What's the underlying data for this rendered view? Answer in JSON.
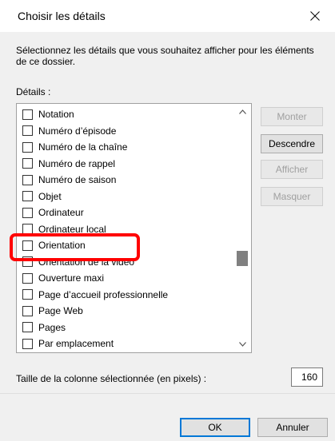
{
  "window": {
    "title": "Choisir les détails",
    "close_icon": "close-icon"
  },
  "description": "Sélectionnez les détails que vous souhaitez afficher pour les éléments de ce dossier.",
  "details_label": "Détails :",
  "list": {
    "items": [
      {
        "label": "Notation",
        "checked": false
      },
      {
        "label": "Numéro d’épisode",
        "checked": false
      },
      {
        "label": "Numéro de la chaîne",
        "checked": false
      },
      {
        "label": "Numéro de rappel",
        "checked": false
      },
      {
        "label": "Numéro de saison",
        "checked": false
      },
      {
        "label": "Objet",
        "checked": false
      },
      {
        "label": "Ordinateur",
        "checked": false
      },
      {
        "label": "Ordinateur local",
        "checked": false
      },
      {
        "label": "Orientation",
        "checked": false
      },
      {
        "label": "Orientation de la vidéo",
        "checked": false
      },
      {
        "label": "Ouverture maxi",
        "checked": false
      },
      {
        "label": "Page d’accueil professionnelle",
        "checked": false
      },
      {
        "label": "Page Web",
        "checked": false
      },
      {
        "label": "Pages",
        "checked": false
      },
      {
        "label": "Par emplacement",
        "checked": false
      }
    ],
    "highlighted_item": "Orientation",
    "highlight_color": "#ff0000"
  },
  "buttons": {
    "move_up": "Monter",
    "move_down": "Descendre",
    "show": "Afficher",
    "hide": "Masquer",
    "ok": "OK",
    "cancel": "Annuler"
  },
  "column_width": {
    "label": "Taille de la colonne sélectionnée (en pixels) :",
    "value": "160"
  },
  "colors": {
    "accent": "#0078d7",
    "disabled_text": "#a0a0a0"
  }
}
